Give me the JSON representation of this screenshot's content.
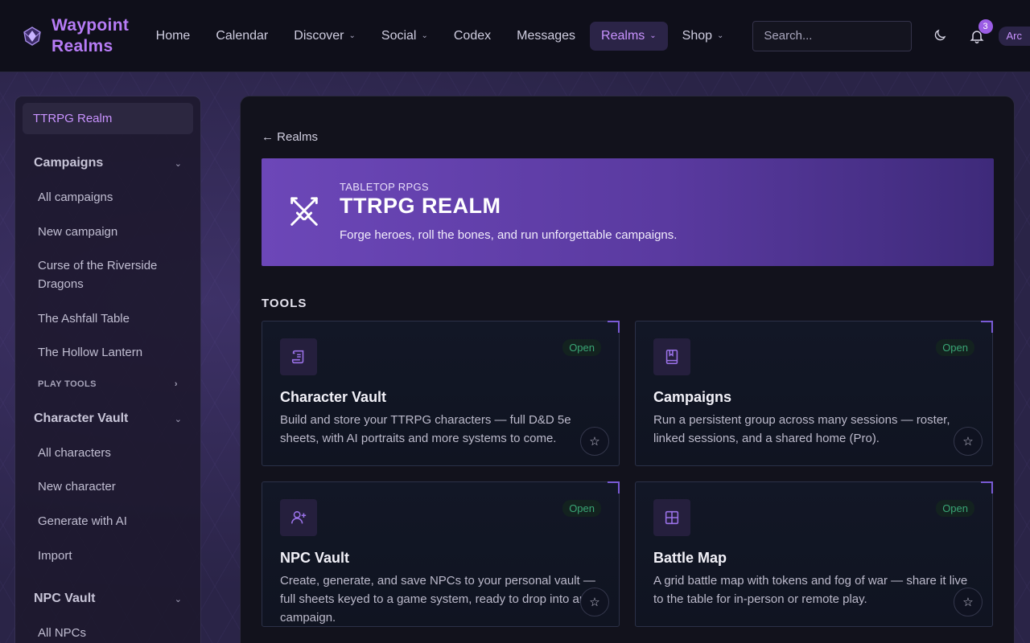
{
  "brand": {
    "name_line1": "Waypoint",
    "name_line2": "Realms"
  },
  "nav": [
    {
      "label": "Home",
      "dropdown": false,
      "active": false
    },
    {
      "label": "Calendar",
      "dropdown": false,
      "active": false
    },
    {
      "label": "Discover",
      "dropdown": true,
      "active": false
    },
    {
      "label": "Social",
      "dropdown": true,
      "active": false
    },
    {
      "label": "Codex",
      "dropdown": false,
      "active": false
    },
    {
      "label": "Messages",
      "dropdown": false,
      "active": false
    },
    {
      "label": "Realms",
      "dropdown": true,
      "active": true
    },
    {
      "label": "Shop",
      "dropdown": true,
      "active": false
    }
  ],
  "search": {
    "placeholder": "Search..."
  },
  "notifications": {
    "count": "3",
    "icon": "bell-icon"
  },
  "theme_toggle": {
    "icon": "moon-icon"
  },
  "user": {
    "label": "Arc"
  },
  "sidebar": {
    "active": "TTRPG Realm",
    "campaigns": {
      "title": "Campaigns",
      "items": [
        "All campaigns",
        "New campaign",
        "Curse of the Riverside Dragons",
        "The Ashfall Table",
        "The Hollow Lantern"
      ],
      "play_tools": "PLAY TOOLS"
    },
    "character_vault": {
      "title": "Character Vault",
      "items": [
        "All characters",
        "New character",
        "Generate with AI",
        "Import"
      ]
    },
    "npc_vault": {
      "title": "NPC Vault",
      "items": [
        "All NPCs"
      ]
    }
  },
  "main": {
    "back_label": "← Realms",
    "hero": {
      "eyebrow": "TABLETOP RPGS",
      "title": "TTRPG REALM",
      "description": "Forge heroes, roll the bones, and run unforgettable campaigns.",
      "icon": "crossed-swords-icon"
    },
    "tools_heading": "TOOLS",
    "cards": [
      {
        "title": "Character Vault",
        "status": "Open",
        "icon": "scroll-icon",
        "description": "Build and store your TTRPG characters — full D&D 5e sheets, with AI portraits and more systems to come."
      },
      {
        "title": "Campaigns",
        "status": "Open",
        "icon": "book-icon",
        "description": "Run a persistent group across many sessions — roster, linked sessions, and a shared home (Pro)."
      },
      {
        "title": "NPC Vault",
        "status": "Open",
        "icon": "user-plus-icon",
        "description": "Create, generate, and save NPCs to your personal vault — full sheets keyed to a game system, ready to drop into any campaign."
      },
      {
        "title": "Battle Map",
        "status": "Open",
        "icon": "grid-icon",
        "description": "A grid battle map with tokens and fog of war — share it live to the table for in-person or remote play."
      }
    ],
    "favorite_glyph": "☆"
  },
  "colors": {
    "accent": "#b77cf6",
    "status_open": "#3aa776",
    "hero_start": "#6c47b8",
    "hero_end": "#3e2a7a"
  }
}
